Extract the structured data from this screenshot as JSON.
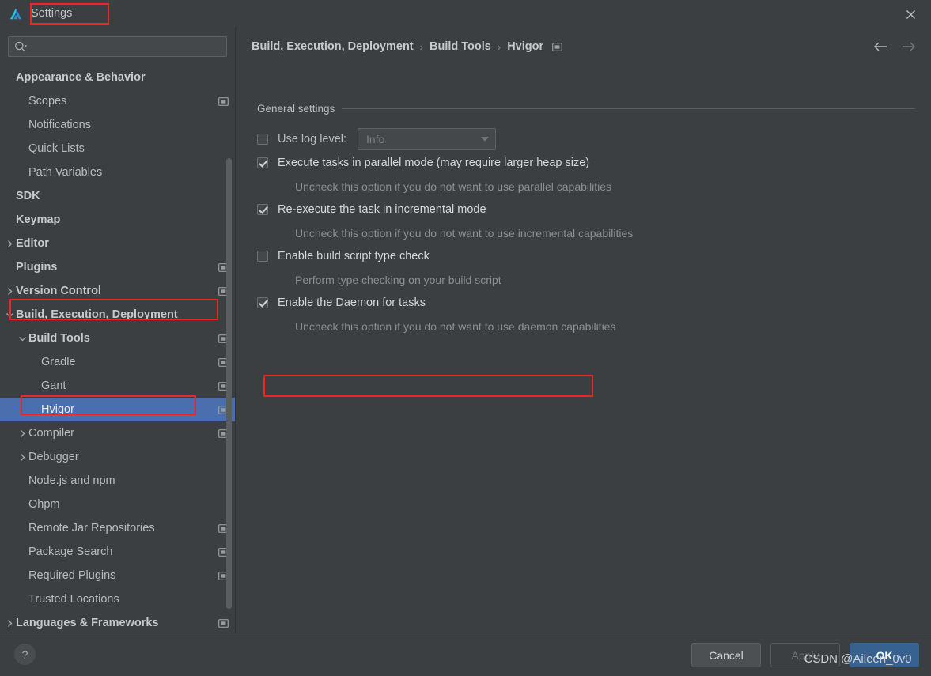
{
  "window": {
    "title": "Settings",
    "logo_icon": "deveco-logo-icon",
    "close_icon": "close-icon"
  },
  "sidebar": {
    "search": {
      "value": "",
      "placeholder": "",
      "icon": "search-icon"
    },
    "items": [
      {
        "label": "Appearance & Behavior",
        "indent": 1,
        "bold": true,
        "twisty": "",
        "project_icon": false
      },
      {
        "label": "Scopes",
        "indent": 2,
        "bold": false,
        "twisty": "",
        "project_icon": true
      },
      {
        "label": "Notifications",
        "indent": 2,
        "bold": false,
        "twisty": "",
        "project_icon": false
      },
      {
        "label": "Quick Lists",
        "indent": 2,
        "bold": false,
        "twisty": "",
        "project_icon": false
      },
      {
        "label": "Path Variables",
        "indent": 2,
        "bold": false,
        "twisty": "",
        "project_icon": false
      },
      {
        "label": "SDK",
        "indent": 1,
        "bold": true,
        "twisty": "",
        "project_icon": false
      },
      {
        "label": "Keymap",
        "indent": 1,
        "bold": true,
        "twisty": "",
        "project_icon": false
      },
      {
        "label": "Editor",
        "indent": 1,
        "bold": true,
        "twisty": "collapsed",
        "project_icon": false
      },
      {
        "label": "Plugins",
        "indent": 1,
        "bold": true,
        "twisty": "",
        "project_icon": true
      },
      {
        "label": "Version Control",
        "indent": 1,
        "bold": true,
        "twisty": "collapsed",
        "project_icon": true
      },
      {
        "label": "Build, Execution, Deployment",
        "indent": 1,
        "bold": true,
        "twisty": "expanded",
        "project_icon": false
      },
      {
        "label": "Build Tools",
        "indent": 2,
        "bold": true,
        "twisty": "expanded",
        "project_icon": true
      },
      {
        "label": "Gradle",
        "indent": 3,
        "bold": false,
        "twisty": "",
        "project_icon": true
      },
      {
        "label": "Gant",
        "indent": 3,
        "bold": false,
        "twisty": "",
        "project_icon": true
      },
      {
        "label": "Hvigor",
        "indent": 3,
        "bold": false,
        "twisty": "",
        "project_icon": true,
        "selected": true
      },
      {
        "label": "Compiler",
        "indent": 2,
        "bold": false,
        "twisty": "collapsed",
        "project_icon": true
      },
      {
        "label": "Debugger",
        "indent": 2,
        "bold": false,
        "twisty": "collapsed",
        "project_icon": false
      },
      {
        "label": "Node.js and npm",
        "indent": 2,
        "bold": false,
        "twisty": "",
        "project_icon": false
      },
      {
        "label": "Ohpm",
        "indent": 2,
        "bold": false,
        "twisty": "",
        "project_icon": false
      },
      {
        "label": "Remote Jar Repositories",
        "indent": 2,
        "bold": false,
        "twisty": "",
        "project_icon": true
      },
      {
        "label": "Package Search",
        "indent": 2,
        "bold": false,
        "twisty": "",
        "project_icon": true
      },
      {
        "label": "Required Plugins",
        "indent": 2,
        "bold": false,
        "twisty": "",
        "project_icon": true
      },
      {
        "label": "Trusted Locations",
        "indent": 2,
        "bold": false,
        "twisty": "",
        "project_icon": false
      },
      {
        "label": "Languages & Frameworks",
        "indent": 1,
        "bold": true,
        "twisty": "collapsed",
        "project_icon": true
      }
    ]
  },
  "main": {
    "breadcrumb": [
      "Build, Execution, Deployment",
      "Build Tools",
      "Hvigor"
    ],
    "breadcrumb_separator": "›",
    "breadcrumb_icon": "project-settings-icon",
    "nav_back_icon": "arrow-left-icon",
    "nav_forward_icon": "arrow-right-icon",
    "section_title": "General settings",
    "log_level": {
      "label": "Use log level:",
      "checked": false,
      "value": "Info",
      "arrow_icon": "chevron-down-icon"
    },
    "options": [
      {
        "label": "Execute tasks in parallel mode (may require larger heap size)",
        "checked": true,
        "hint": "Uncheck this option if you do not want to use parallel capabilities"
      },
      {
        "label": "Re-execute the task in incremental mode",
        "checked": true,
        "hint": "Uncheck this option if you do not want to use incremental capabilities"
      },
      {
        "label": "Enable build script type check",
        "checked": false,
        "hint": "Perform type checking on your build script"
      },
      {
        "label": "Enable the Daemon for tasks",
        "checked": true,
        "hint": "Uncheck this option if you do not want to use daemon capabilities"
      }
    ]
  },
  "footer": {
    "help_label": "?",
    "cancel_label": "Cancel",
    "apply_label": "Apply",
    "ok_label": "OK"
  },
  "watermark": "CSDN @Aileen_0v0",
  "colors": {
    "background": "#3c3f41",
    "selection_blue": "#4b6eaf",
    "highlight_red": "#ef2424",
    "primary_button": "#37628f",
    "text": "#bbbbbb",
    "hint_text": "#8c8f90"
  }
}
